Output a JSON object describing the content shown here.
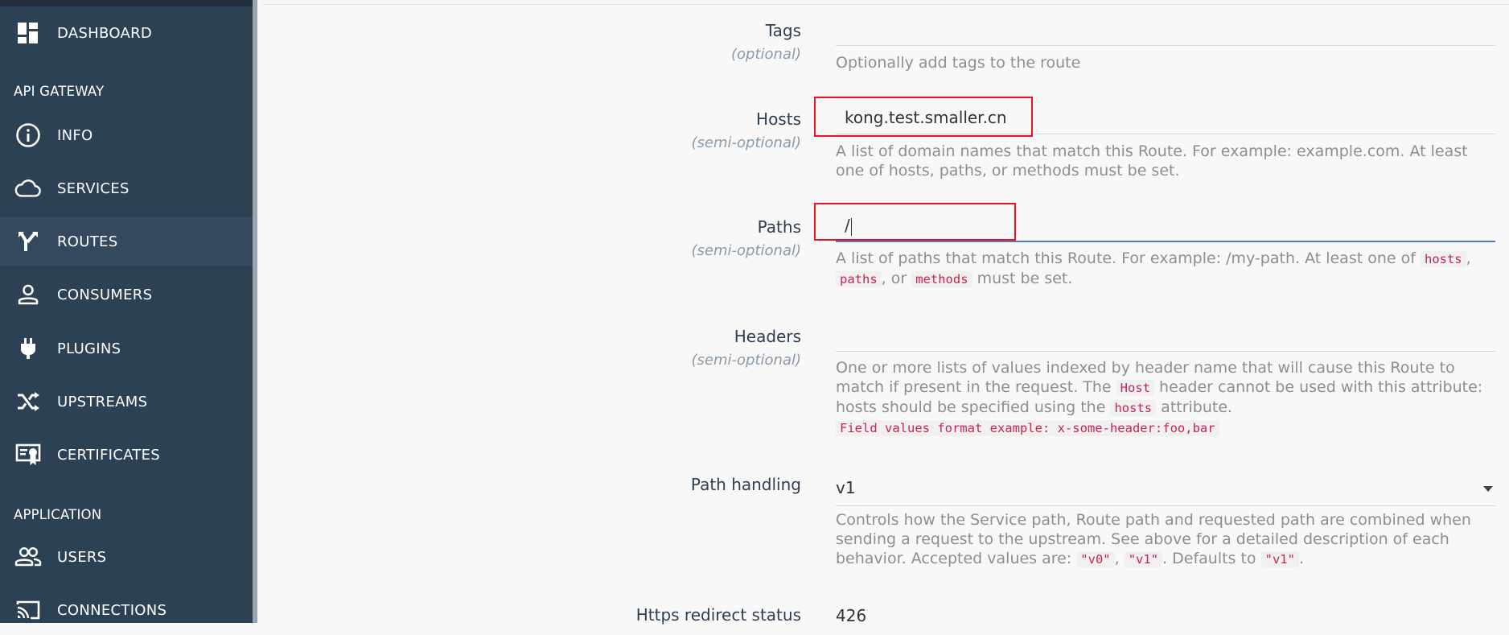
{
  "sidebar": {
    "items": [
      {
        "label": "DASHBOARD",
        "icon": "dashboard-icon"
      },
      {
        "label": "INFO",
        "icon": "info-icon"
      },
      {
        "label": "SERVICES",
        "icon": "cloud-icon"
      },
      {
        "label": "ROUTES",
        "icon": "routes-icon",
        "active": true
      },
      {
        "label": "CONSUMERS",
        "icon": "person-icon"
      },
      {
        "label": "PLUGINS",
        "icon": "plug-icon"
      },
      {
        "label": "UPSTREAMS",
        "icon": "shuffle-icon"
      },
      {
        "label": "CERTIFICATES",
        "icon": "certificate-icon"
      },
      {
        "label": "USERS",
        "icon": "users-icon"
      },
      {
        "label": "CONNECTIONS",
        "icon": "cast-icon"
      }
    ],
    "sections": {
      "api_gateway": "API GATEWAY",
      "application": "APPLICATION"
    }
  },
  "form": {
    "tags": {
      "label": "Tags",
      "sub": "(optional)",
      "value": "",
      "help": "Optionally add tags to the route"
    },
    "hosts": {
      "label": "Hosts",
      "sub": "(semi-optional)",
      "value": "kong.test.smaller.cn",
      "help": "A list of domain names that match this Route. For example: example.com. At least one of hosts, paths, or methods must be set."
    },
    "paths": {
      "label": "Paths",
      "sub": "(semi-optional)",
      "value": "/",
      "help_pre": "A list of paths that match this Route. For example: /my-path. At least one of",
      "code_hosts": "hosts",
      "sep1": ",",
      "code_paths": "paths",
      "sep2": ", or",
      "code_methods": "methods",
      "help_post": "must be set."
    },
    "headers": {
      "label": "Headers",
      "sub": "(semi-optional)",
      "value": "",
      "help_pre": "One or more lists of values indexed by header name that will cause this Route to match if present in the request. The",
      "code_host": "Host",
      "help_mid": "header cannot be used with this attribute: hosts should be specified using the",
      "code_hosts": "hosts",
      "help_post": "attribute.",
      "example": "Field values format example: x-some-header:foo,bar"
    },
    "path_handling": {
      "label": "Path handling",
      "value": "v1",
      "help_pre": "Controls how the Service path, Route path and requested path are combined when sending a request to the upstream. See above for a detailed description of each behavior. Accepted values are:",
      "code_v0": "\"v0\"",
      "sep": ",",
      "code_v1": "\"v1\"",
      "help_mid": ". Defaults to",
      "code_default": "\"v1\"",
      "help_post": "."
    },
    "https_redirect": {
      "label": "Https redirect status",
      "value": "426"
    }
  },
  "colors": {
    "sidebar_bg": "#2d4155",
    "sidebar_active": "#34495e",
    "highlight_box": "#e8141f",
    "code_text": "#c7254e",
    "focus_line": "#4a7bd0"
  }
}
